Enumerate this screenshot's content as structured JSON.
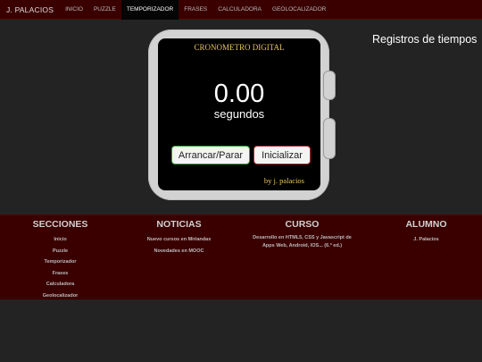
{
  "nav": {
    "brand": "J. PALACIOS",
    "items": [
      "INICIO",
      "PUZZLE",
      "TEMPORIZADOR",
      "FRASES",
      "CALCULADORA",
      "GEOLOCALIZADOR"
    ],
    "active": "TEMPORIZADOR"
  },
  "watch": {
    "title": "CRONOMETRO DIGITAL",
    "time": "0.00",
    "unit": "segundos",
    "start_stop_label": "Arrancar/Parar",
    "reset_label": "Inicializar",
    "signature": "by j. palacios"
  },
  "records": {
    "title": "Registros de tiempos"
  },
  "footer": {
    "secciones": {
      "title": "SECCIONES",
      "items": [
        "Inicio",
        "Puzzle",
        "Temporizador",
        "Frases",
        "Calculadora",
        "Geolocalizador"
      ]
    },
    "noticias": {
      "title": "NOTICIAS",
      "items": [
        "Nuevo cursos en Miriandax",
        "Novedades en MOOC"
      ]
    },
    "curso": {
      "title": "CURSO",
      "text": "Desarrollo en HTML5, CSS y Javascript de Apps Web, Android, IOS... (6.ª ed.)"
    },
    "alumno": {
      "title": "ALUMNO",
      "name": "J. Palacios"
    }
  },
  "colors": {
    "nav_bg": "#3a0000",
    "active_bg": "#050505",
    "page_bg": "#232323",
    "accent_gold": "#e6c35a",
    "start_border": "#3da33d",
    "reset_border": "#b03030"
  }
}
